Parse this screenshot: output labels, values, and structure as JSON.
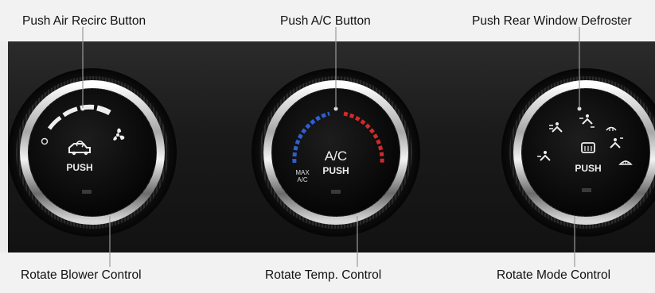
{
  "labels": {
    "top_left": "Push Air Recirc Button",
    "top_center": "Push A/C Button",
    "top_right": "Push Rear Window Defroster",
    "bottom_left": "Rotate Blower Control",
    "bottom_center": "Rotate Temp. Control",
    "bottom_right": "Rotate Mode Control"
  },
  "knobs": {
    "blower": {
      "push": "PUSH"
    },
    "temp": {
      "main": "A/C",
      "push": "PUSH",
      "max": "MAX",
      "max_sub": "A/C"
    },
    "mode": {
      "push": "PUSH"
    }
  },
  "colors": {
    "panel": "#1a1a1a",
    "chrome": "#d9d9d9",
    "cold": "#2f5fd0",
    "hot": "#d12a2a",
    "knob_face": "#0b0b0b"
  },
  "icons": {
    "recirc": "car-recirc-icon",
    "fan": "fan-icon",
    "rear_defrost": "rear-defrost-icon",
    "vent_face": "vent-face-icon",
    "vent_floor": "vent-floor-icon",
    "windshield": "windshield-defrost-icon"
  }
}
